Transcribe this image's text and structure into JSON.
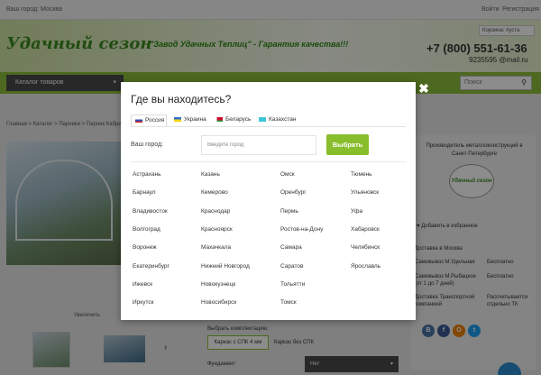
{
  "topbar": {
    "city": "Ваш город: Москва",
    "login": "Войти",
    "register": "Регистрация"
  },
  "header": {
    "logo": "Удачный сезон",
    "slogan": "\"Завод Удачных Теплиц\" - Гарантия качества!!!",
    "cart": "Корзина: пуста",
    "phone": "+7 (800) 551-61-36",
    "email": "9235595 @mail.ru"
  },
  "nav": {
    "catalog_label": "Каталог товаров",
    "search_placeholder": "Поиск"
  },
  "breadcrumb": "Главная  >  Каталог  >  Парники  >  Парник Кабриолет",
  "product": {
    "zoom_label": "Увеличить"
  },
  "right_panel": {
    "manufacturer": "Производитель металлоконструкций в Санкт-Петербурге",
    "logo_text": "Удачный сезон",
    "favorite": "Добавить в избранное",
    "rows": [
      {
        "label": "Доставка в Москва",
        "value": ""
      },
      {
        "label": "Самовывоз М.Удельная",
        "value": "Бесплатно"
      },
      {
        "label": "Самовывоз М.Рыбацкое (от 1 до 7 дней)",
        "value": "Бесплатно"
      },
      {
        "label": "Доставка Транспортной компанией",
        "value": "Рассчитывается отдельно ТК"
      }
    ],
    "social": [
      "В",
      "f",
      "О",
      "t"
    ]
  },
  "config": {
    "label": "Выбрать комплектацию:",
    "option1": "Каркас с СПК 4 мм",
    "option2": "Каркас без СПК",
    "foundation_label": "Фундамент",
    "foundation_value": "Нет"
  },
  "modal": {
    "title": "Где вы находитесь?",
    "countries": [
      {
        "label": "Россия",
        "active": true
      },
      {
        "label": "Украина",
        "active": false
      },
      {
        "label": "Беларусь",
        "active": false
      },
      {
        "label": "Казахстан",
        "active": false
      }
    ],
    "city_label": "Ваш город:",
    "city_placeholder": "Введите город",
    "submit_label": "Выбрать",
    "close_label": "✖",
    "city_columns": [
      [
        "Астрахань",
        "Барнаул",
        "Владивосток",
        "Волгоград",
        "Воронеж",
        "Екатеринбург",
        "Ижевск",
        "Иркутск"
      ],
      [
        "Казань",
        "Кемерово",
        "Краснодар",
        "Красноярск",
        "Махачкала",
        "Нижний Новгород",
        "Новокузнецк",
        "Новосибирск"
      ],
      [
        "Омск",
        "Оренбург",
        "Пермь",
        "Ростов-на-Дону",
        "Самара",
        "Саратов",
        "Тольятти",
        "Томск"
      ],
      [
        "Тюмень",
        "Ульяновск",
        "Уфа",
        "Хабаровск",
        "Челябинск",
        "Ярославль"
      ]
    ]
  }
}
